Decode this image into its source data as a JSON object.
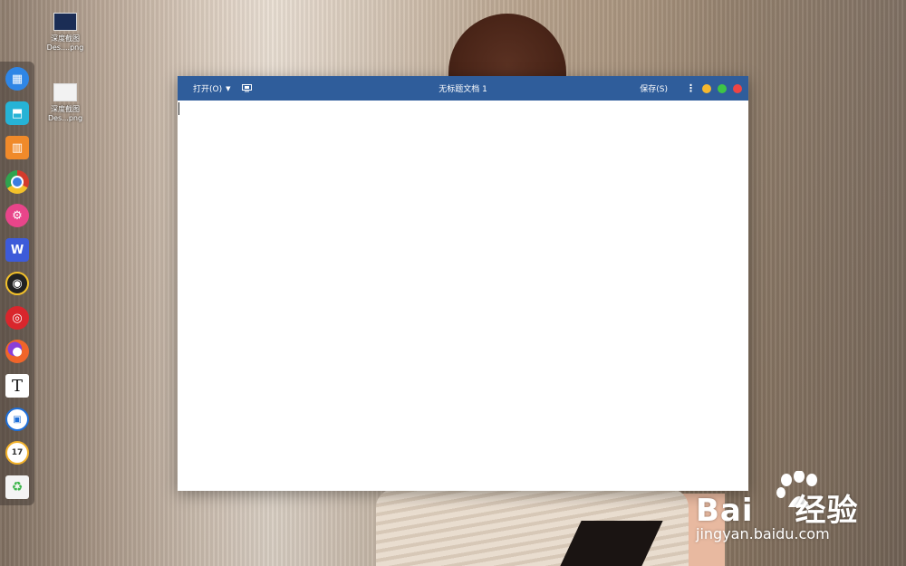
{
  "desktop": {
    "icons": [
      {
        "label_line1": "深度截图",
        "label_line2": "Des....png"
      },
      {
        "label_line1": "深度截图",
        "label_line2": "Des...png"
      }
    ]
  },
  "dock": {
    "items": [
      {
        "icon": "launcher-icon",
        "color": "#2f86e6"
      },
      {
        "icon": "app-store-icon",
        "color": "#26b3d6"
      },
      {
        "icon": "shopping-bag-icon",
        "color": "#f08a2a"
      },
      {
        "icon": "chrome-icon",
        "color": "#d33b2c"
      },
      {
        "icon": "settings-icon",
        "color": "#e8458a"
      },
      {
        "icon": "wps-writer-icon",
        "color": "#3d5bd9"
      },
      {
        "icon": "music-player-icon",
        "color": "#222222"
      },
      {
        "icon": "netease-music-icon",
        "color": "#d9262c"
      },
      {
        "icon": "firefox-icon",
        "color": "#f0652a"
      },
      {
        "icon": "text-editor-icon",
        "color": "#ffffff"
      },
      {
        "icon": "screen-recorder-icon",
        "color": "#1e6fd9"
      },
      {
        "icon": "calendar-icon",
        "color": "#f3b22a"
      },
      {
        "icon": "trash-icon",
        "color": "#ffffff"
      }
    ]
  },
  "window": {
    "open_label": "打开(O)",
    "title": "无标题文档 1",
    "save_label": "保存(S)",
    "buttons": {
      "minimize_color": "#f5b82e",
      "maximize_color": "#3ec546",
      "close_color": "#ef4444"
    },
    "accent": "#2f5d9b"
  },
  "watermark": {
    "brand": "Bai",
    "brand_cn": "经验",
    "url": "jingyan.baidu.com"
  }
}
